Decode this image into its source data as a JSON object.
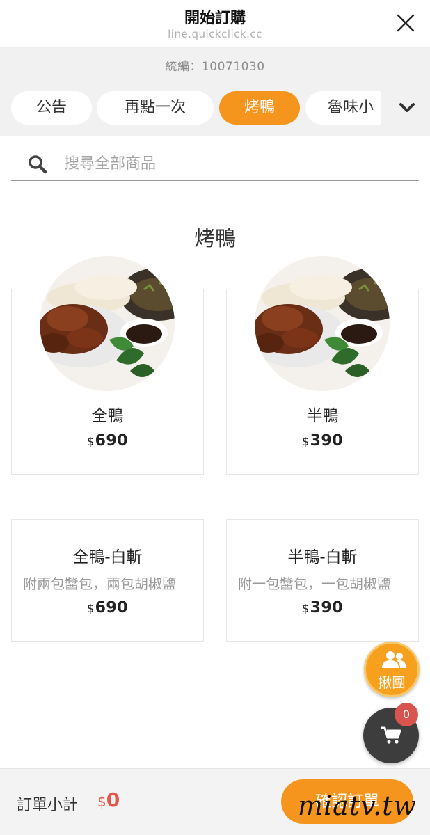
{
  "header": {
    "title": "開始訂購",
    "url": "line.quickclick.cc"
  },
  "tax_id": "統編：10071030",
  "tabs": [
    {
      "label": "公告",
      "active": false
    },
    {
      "label": "再點一次",
      "active": false
    },
    {
      "label": "烤鴨",
      "active": true
    },
    {
      "label": "魯味小",
      "active": false
    }
  ],
  "search": {
    "placeholder": "搜尋全部商品",
    "value": ""
  },
  "section": {
    "title": "烤鴨"
  },
  "products": [
    {
      "name": "全鴨",
      "currency": "$",
      "price": "690",
      "description": ""
    },
    {
      "name": "半鴨",
      "currency": "$",
      "price": "390",
      "description": ""
    },
    {
      "name": "全鴨-白斬",
      "currency": "$",
      "price": "690",
      "description": "附兩包醬包，兩包胡椒鹽"
    },
    {
      "name": "半鴨-白斬",
      "currency": "$",
      "price": "390",
      "description": "附一包醬包，一包胡椒鹽"
    }
  ],
  "group_button": {
    "label": "揪團",
    "icon": "group-icon"
  },
  "cart": {
    "count": "0",
    "icon": "cart-icon"
  },
  "footer": {
    "subtotal_label": "訂單小計",
    "subtotal_currency": "$",
    "subtotal_value": "0",
    "confirm_label": "確認訂單"
  },
  "watermark": "miatv.tw",
  "colors": {
    "accent": "#f5951d",
    "price_red": "#e2574c",
    "badge_red": "#d9534f"
  }
}
